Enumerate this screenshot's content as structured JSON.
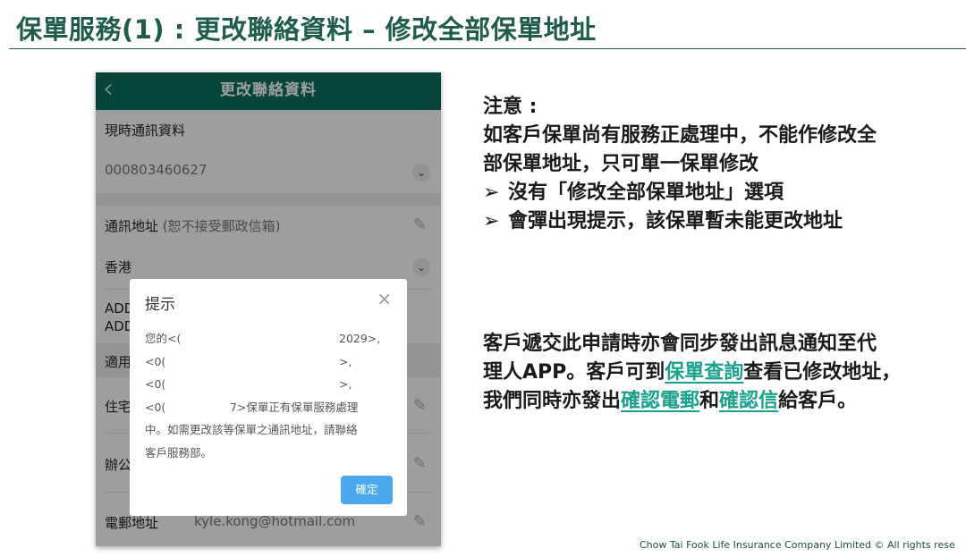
{
  "slide": {
    "title": "保單服務(1) : 更改聯絡資料 – 修改全部保單地址",
    "footer": "Chow Tai Fook Life Insurance Company Limited © All rights rese"
  },
  "phone": {
    "app_title": "更改聯絡資料",
    "current_contact_label": "現時通訊資料",
    "policy_number": "000803460627",
    "address_label": "通訊地址",
    "address_note": "(恕不接受郵政信箱)",
    "region": "香港",
    "add_line1": "ADD",
    "add_line2": "ADD",
    "applicable": "適用",
    "home": "住宅",
    "office": "辦公",
    "email_label": "電郵地址",
    "email_value": "kyle.kong@hotmail.com"
  },
  "dialog": {
    "title": "提示",
    "line1_left": "您的<(",
    "line1_right": "2029>,",
    "line2_left": "<0(",
    "line2_right": ">,",
    "line3_left": "<0(",
    "line3_right": ">,",
    "line4_left": "<0(",
    "line4_right": "7>保單正有保單服務處理",
    "line5": "中。如需更改該等保單之通訊地址，請聯絡",
    "line6": "客戶服務部。",
    "confirm": "確定"
  },
  "notes": {
    "heading": "注意 :",
    "line1": "如客戶保單尚有服務正處理中，不能作修改全",
    "line2": "部保單地址，只可單一保單修改",
    "bullet_symbol": "➢",
    "bullet1": "沒有「修改全部保單地址」選項",
    "bullet2": "會彈出現提示，該保單暫未能更改地址"
  },
  "info": {
    "l1": "客戶遞交此申請時亦會同步發出訊息通知至代",
    "l2_a": "理人APP。客戶可到",
    "l2_link": "保單查詢",
    "l2_b": "查看已修改地址，",
    "l3_a": "我們同時亦發出",
    "l3_link1": "確認電郵",
    "l3_mid": "和",
    "l3_link2": "確認信",
    "l3_b": "給客戶。"
  },
  "colors": {
    "title_green": "#1f5c4c",
    "app_bar": "#0c6e5f",
    "highlight": "#1aa08c",
    "button_blue": "#4aa9ec"
  },
  "icons": [
    "back-chevron-icon",
    "chevron-down-icon",
    "pencil-icon",
    "close-icon"
  ]
}
